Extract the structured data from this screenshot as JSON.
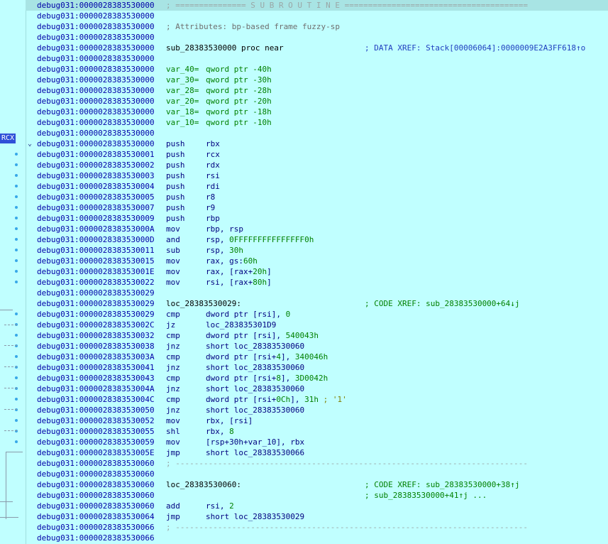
{
  "gutter": {
    "register_tag": "RCX"
  },
  "listing": [
    {
      "addr": "debug031:0000028383530000",
      "hl": true,
      "kind": "sep",
      "text": "; =============== S U B R O U T I N E ======================================="
    },
    {
      "addr": "debug031:0000028383530000",
      "kind": "blank"
    },
    {
      "addr": "debug031:0000028383530000",
      "kind": "comment",
      "text": "; Attributes: bp-based frame fuzzy-sp"
    },
    {
      "addr": "debug031:0000028383530000",
      "kind": "blank"
    },
    {
      "addr": "debug031:0000028383530000",
      "kind": "proc",
      "label": "sub_28383530000 proc near",
      "xref": "; DATA XREF: Stack[00006064]:0000009E2A3FF618↑o"
    },
    {
      "addr": "debug031:0000028383530000",
      "kind": "blank"
    },
    {
      "addr": "debug031:0000028383530000",
      "kind": "var",
      "name": "var_40=",
      "type": "qword ptr -40h"
    },
    {
      "addr": "debug031:0000028383530000",
      "kind": "var",
      "name": "var_30=",
      "type": "qword ptr -30h"
    },
    {
      "addr": "debug031:0000028383530000",
      "kind": "var",
      "name": "var_28=",
      "type": "qword ptr -28h"
    },
    {
      "addr": "debug031:0000028383530000",
      "kind": "var",
      "name": "var_20=",
      "type": "qword ptr -20h"
    },
    {
      "addr": "debug031:0000028383530000",
      "kind": "var",
      "name": "var_18=",
      "type": "qword ptr -18h"
    },
    {
      "addr": "debug031:0000028383530000",
      "kind": "var",
      "name": "var_10=",
      "type": "qword ptr -10h"
    },
    {
      "addr": "debug031:0000028383530000",
      "kind": "blank"
    },
    {
      "addr": "debug031:0000028383530000",
      "kind": "insn",
      "fold": true,
      "mnem": "push",
      "ops": "rbx"
    },
    {
      "addr": "debug031:0000028383530001",
      "kind": "insn",
      "mnem": "push",
      "ops": "rcx"
    },
    {
      "addr": "debug031:0000028383530002",
      "kind": "insn",
      "mnem": "push",
      "ops": "rdx"
    },
    {
      "addr": "debug031:0000028383530003",
      "kind": "insn",
      "mnem": "push",
      "ops": "rsi"
    },
    {
      "addr": "debug031:0000028383530004",
      "kind": "insn",
      "mnem": "push",
      "ops": "rdi"
    },
    {
      "addr": "debug031:0000028383530005",
      "kind": "insn",
      "mnem": "push",
      "ops": "r8"
    },
    {
      "addr": "debug031:0000028383530007",
      "kind": "insn",
      "mnem": "push",
      "ops": "r9"
    },
    {
      "addr": "debug031:0000028383530009",
      "kind": "insn",
      "mnem": "push",
      "ops": "rbp"
    },
    {
      "addr": "debug031:000002838353000A",
      "kind": "insn",
      "mnem": "mov",
      "ops": "rbp, rsp"
    },
    {
      "addr": "debug031:000002838353000D",
      "kind": "insn",
      "mnem": "and",
      "ops": "rsp, ",
      "num": "0FFFFFFFFFFFFFFF0h"
    },
    {
      "addr": "debug031:0000028383530011",
      "kind": "insn",
      "mnem": "sub",
      "ops": "rsp, ",
      "num": "30h"
    },
    {
      "addr": "debug031:0000028383530015",
      "kind": "insn",
      "mnem": "mov",
      "ops": "rax, gs:",
      "num": "60h"
    },
    {
      "addr": "debug031:000002838353001E",
      "kind": "insn",
      "mnem": "mov",
      "ops": "rax, [rax+",
      "num": "20h",
      "post": "]"
    },
    {
      "addr": "debug031:0000028383530022",
      "kind": "insn",
      "mnem": "mov",
      "ops": "rsi, [rax+",
      "num": "80h",
      "post": "]"
    },
    {
      "addr": "debug031:0000028383530029",
      "kind": "blank"
    },
    {
      "addr": "debug031:0000028383530029",
      "kind": "label",
      "label": "loc_28383530029:",
      "xref": "; CODE XREF: sub_28383530000+64↓j"
    },
    {
      "addr": "debug031:0000028383530029",
      "kind": "insn",
      "mnem": "cmp",
      "ops": "dword ptr [rsi], ",
      "num": "0"
    },
    {
      "addr": "debug031:000002838353002C",
      "kind": "insn",
      "mnem": "jz",
      "ops": "loc_283835301D9"
    },
    {
      "addr": "debug031:0000028383530032",
      "kind": "insn",
      "mnem": "cmp",
      "ops": "dword ptr [rsi], ",
      "num": "540043h"
    },
    {
      "addr": "debug031:0000028383530038",
      "kind": "insn",
      "mnem": "jnz",
      "ops": "short loc_28383530060"
    },
    {
      "addr": "debug031:000002838353003A",
      "kind": "insn",
      "mnem": "cmp",
      "ops": "dword ptr [rsi+",
      "num": "4",
      "post": "], ",
      "num2": "340046h"
    },
    {
      "addr": "debug031:0000028383530041",
      "kind": "insn",
      "mnem": "jnz",
      "ops": "short loc_28383530060"
    },
    {
      "addr": "debug031:0000028383530043",
      "kind": "insn",
      "mnem": "cmp",
      "ops": "dword ptr [rsi+",
      "num": "8",
      "post": "], ",
      "num2": "3D0042h"
    },
    {
      "addr": "debug031:000002838353004A",
      "kind": "insn",
      "mnem": "jnz",
      "ops": "short loc_28383530060"
    },
    {
      "addr": "debug031:000002838353004C",
      "kind": "insn",
      "mnem": "cmp",
      "ops": "dword ptr [rsi+",
      "num": "0Ch",
      "post": "], ",
      "num2": "31h",
      "str": " ; '1'"
    },
    {
      "addr": "debug031:0000028383530050",
      "kind": "insn",
      "mnem": "jnz",
      "ops": "short loc_28383530060"
    },
    {
      "addr": "debug031:0000028383530052",
      "kind": "insn",
      "mnem": "mov",
      "ops": "rbx, [rsi]"
    },
    {
      "addr": "debug031:0000028383530055",
      "kind": "insn",
      "mnem": "shl",
      "ops": "rbx, ",
      "num": "8"
    },
    {
      "addr": "debug031:0000028383530059",
      "kind": "insn",
      "mnem": "mov",
      "ops": "[rsp+30h+var_10], rbx"
    },
    {
      "addr": "debug031:000002838353005E",
      "kind": "insn",
      "mnem": "jmp",
      "ops": "short loc_28383530066"
    },
    {
      "addr": "debug031:0000028383530060",
      "kind": "sep",
      "text": "; ---------------------------------------------------------------------------"
    },
    {
      "addr": "debug031:0000028383530060",
      "kind": "blank"
    },
    {
      "addr": "debug031:0000028383530060",
      "kind": "label",
      "label": "loc_28383530060:",
      "xref": "; CODE XREF: sub_28383530000+38↑j"
    },
    {
      "addr": "debug031:0000028383530060",
      "kind": "xrefcont",
      "xref": "; sub_28383530000+41↑j ..."
    },
    {
      "addr": "debug031:0000028383530060",
      "kind": "insn",
      "mnem": "add",
      "ops": "rsi, ",
      "num": "2"
    },
    {
      "addr": "debug031:0000028383530064",
      "kind": "insn",
      "mnem": "jmp",
      "ops": "short loc_28383530029"
    },
    {
      "addr": "debug031:0000028383530066",
      "kind": "sep",
      "text": "; ---------------------------------------------------------------------------"
    },
    {
      "addr": "debug031:0000028383530066",
      "kind": "blank"
    }
  ]
}
